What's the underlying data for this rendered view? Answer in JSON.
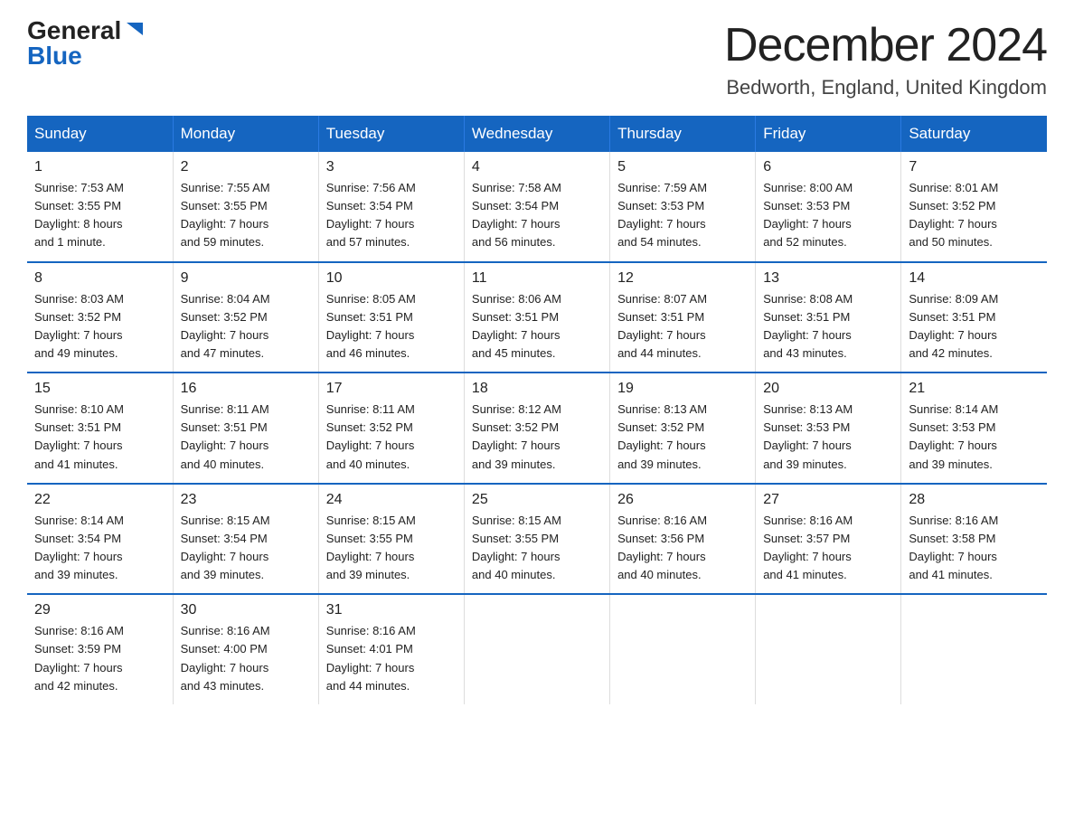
{
  "logo": {
    "general": "General",
    "blue": "Blue"
  },
  "title": "December 2024",
  "location": "Bedworth, England, United Kingdom",
  "days_of_week": [
    "Sunday",
    "Monday",
    "Tuesday",
    "Wednesday",
    "Thursday",
    "Friday",
    "Saturday"
  ],
  "weeks": [
    [
      {
        "day": "1",
        "info": "Sunrise: 7:53 AM\nSunset: 3:55 PM\nDaylight: 8 hours\nand 1 minute."
      },
      {
        "day": "2",
        "info": "Sunrise: 7:55 AM\nSunset: 3:55 PM\nDaylight: 7 hours\nand 59 minutes."
      },
      {
        "day": "3",
        "info": "Sunrise: 7:56 AM\nSunset: 3:54 PM\nDaylight: 7 hours\nand 57 minutes."
      },
      {
        "day": "4",
        "info": "Sunrise: 7:58 AM\nSunset: 3:54 PM\nDaylight: 7 hours\nand 56 minutes."
      },
      {
        "day": "5",
        "info": "Sunrise: 7:59 AM\nSunset: 3:53 PM\nDaylight: 7 hours\nand 54 minutes."
      },
      {
        "day": "6",
        "info": "Sunrise: 8:00 AM\nSunset: 3:53 PM\nDaylight: 7 hours\nand 52 minutes."
      },
      {
        "day": "7",
        "info": "Sunrise: 8:01 AM\nSunset: 3:52 PM\nDaylight: 7 hours\nand 50 minutes."
      }
    ],
    [
      {
        "day": "8",
        "info": "Sunrise: 8:03 AM\nSunset: 3:52 PM\nDaylight: 7 hours\nand 49 minutes."
      },
      {
        "day": "9",
        "info": "Sunrise: 8:04 AM\nSunset: 3:52 PM\nDaylight: 7 hours\nand 47 minutes."
      },
      {
        "day": "10",
        "info": "Sunrise: 8:05 AM\nSunset: 3:51 PM\nDaylight: 7 hours\nand 46 minutes."
      },
      {
        "day": "11",
        "info": "Sunrise: 8:06 AM\nSunset: 3:51 PM\nDaylight: 7 hours\nand 45 minutes."
      },
      {
        "day": "12",
        "info": "Sunrise: 8:07 AM\nSunset: 3:51 PM\nDaylight: 7 hours\nand 44 minutes."
      },
      {
        "day": "13",
        "info": "Sunrise: 8:08 AM\nSunset: 3:51 PM\nDaylight: 7 hours\nand 43 minutes."
      },
      {
        "day": "14",
        "info": "Sunrise: 8:09 AM\nSunset: 3:51 PM\nDaylight: 7 hours\nand 42 minutes."
      }
    ],
    [
      {
        "day": "15",
        "info": "Sunrise: 8:10 AM\nSunset: 3:51 PM\nDaylight: 7 hours\nand 41 minutes."
      },
      {
        "day": "16",
        "info": "Sunrise: 8:11 AM\nSunset: 3:51 PM\nDaylight: 7 hours\nand 40 minutes."
      },
      {
        "day": "17",
        "info": "Sunrise: 8:11 AM\nSunset: 3:52 PM\nDaylight: 7 hours\nand 40 minutes."
      },
      {
        "day": "18",
        "info": "Sunrise: 8:12 AM\nSunset: 3:52 PM\nDaylight: 7 hours\nand 39 minutes."
      },
      {
        "day": "19",
        "info": "Sunrise: 8:13 AM\nSunset: 3:52 PM\nDaylight: 7 hours\nand 39 minutes."
      },
      {
        "day": "20",
        "info": "Sunrise: 8:13 AM\nSunset: 3:53 PM\nDaylight: 7 hours\nand 39 minutes."
      },
      {
        "day": "21",
        "info": "Sunrise: 8:14 AM\nSunset: 3:53 PM\nDaylight: 7 hours\nand 39 minutes."
      }
    ],
    [
      {
        "day": "22",
        "info": "Sunrise: 8:14 AM\nSunset: 3:54 PM\nDaylight: 7 hours\nand 39 minutes."
      },
      {
        "day": "23",
        "info": "Sunrise: 8:15 AM\nSunset: 3:54 PM\nDaylight: 7 hours\nand 39 minutes."
      },
      {
        "day": "24",
        "info": "Sunrise: 8:15 AM\nSunset: 3:55 PM\nDaylight: 7 hours\nand 39 minutes."
      },
      {
        "day": "25",
        "info": "Sunrise: 8:15 AM\nSunset: 3:55 PM\nDaylight: 7 hours\nand 40 minutes."
      },
      {
        "day": "26",
        "info": "Sunrise: 8:16 AM\nSunset: 3:56 PM\nDaylight: 7 hours\nand 40 minutes."
      },
      {
        "day": "27",
        "info": "Sunrise: 8:16 AM\nSunset: 3:57 PM\nDaylight: 7 hours\nand 41 minutes."
      },
      {
        "day": "28",
        "info": "Sunrise: 8:16 AM\nSunset: 3:58 PM\nDaylight: 7 hours\nand 41 minutes."
      }
    ],
    [
      {
        "day": "29",
        "info": "Sunrise: 8:16 AM\nSunset: 3:59 PM\nDaylight: 7 hours\nand 42 minutes."
      },
      {
        "day": "30",
        "info": "Sunrise: 8:16 AM\nSunset: 4:00 PM\nDaylight: 7 hours\nand 43 minutes."
      },
      {
        "day": "31",
        "info": "Sunrise: 8:16 AM\nSunset: 4:01 PM\nDaylight: 7 hours\nand 44 minutes."
      },
      {
        "day": "",
        "info": ""
      },
      {
        "day": "",
        "info": ""
      },
      {
        "day": "",
        "info": ""
      },
      {
        "day": "",
        "info": ""
      }
    ]
  ]
}
